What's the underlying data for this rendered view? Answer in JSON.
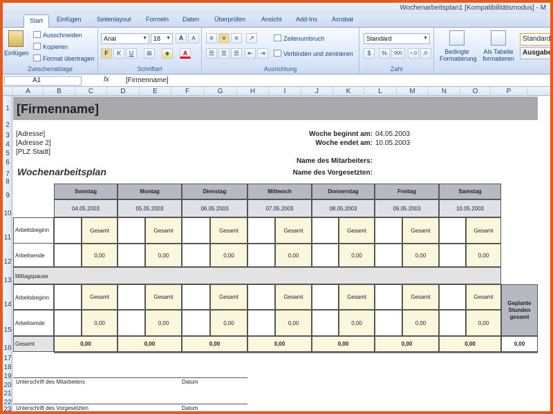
{
  "window": {
    "title": "Wochenarbeitsplan1  [Kompatibilitätsmodus] - M"
  },
  "tabs": [
    "Start",
    "Einfügen",
    "Seitenlayout",
    "Formeln",
    "Daten",
    "Überprüfen",
    "Ansicht",
    "Add-Ins",
    "Acrobat"
  ],
  "ribbon": {
    "clipboard": {
      "label": "Zwischenablage",
      "paste": "Einfügen",
      "cut": "Ausschneiden",
      "copy": "Kopieren",
      "format_painter": "Format übertragen"
    },
    "font": {
      "label": "Schriftart",
      "family": "Arial",
      "size": "18",
      "bold": "F",
      "italic": "K",
      "underline": "U"
    },
    "alignment": {
      "label": "Ausrichtung",
      "wrap": "Zeilenumbruch",
      "merge": "Verbinden und zentrieren"
    },
    "number": {
      "label": "Zahl",
      "format": "Standard",
      "percent": "%",
      "thousands": "000"
    },
    "styles": {
      "conditional": "Bedingte Formatierung",
      "as_table": "Als Tabelle formatieren",
      "style1": "Standard",
      "style2": "Ausgabe"
    }
  },
  "formula_bar": {
    "cell": "A1",
    "fx": "fx",
    "content": "[Firmenname]"
  },
  "columns": [
    "A",
    "B",
    "C",
    "D",
    "E",
    "F",
    "G",
    "H",
    "I",
    "J",
    "K",
    "L",
    "M",
    "N",
    "O",
    "P"
  ],
  "rows": [
    "1",
    "2",
    "3",
    "4",
    "5",
    "6",
    "7",
    "8",
    "9",
    "10",
    "11",
    "12",
    "13",
    "14",
    "15",
    "16",
    "17",
    "18",
    "19",
    "20",
    "21",
    "22",
    "23"
  ],
  "sheet": {
    "company": "[Firmenname]",
    "address": [
      "[Adresse]",
      "[Adresse 2]",
      "[PLZ Stadt]"
    ],
    "week_start_label": "Woche beginnt am:",
    "week_start": "04.05.2003",
    "week_end_label": "Woche endet am:",
    "week_end": "10.05.2003",
    "employee_label": "Name des Mitarbeiters:",
    "supervisor_label": "Name des Vorgesetzten:",
    "plan_title": "Wochenarbeitsplan",
    "days": [
      "Sonntag",
      "Montag",
      "Dienstag",
      "Mittwoch",
      "Donnerstag",
      "Freitag",
      "Samstag"
    ],
    "dates": [
      "04.05.2003",
      "05.05.2003",
      "06.05.2003",
      "07.05.2003",
      "08.05.2003",
      "09.05.2003",
      "10.05.2003"
    ],
    "start_label": "Arbeitsbeginn",
    "end_label": "Arbeitsende",
    "total_label": "Gesamt",
    "lunch_label": "Mittagspause",
    "zero": "0,00",
    "planned_hours": "Geplante Stunden gesamt",
    "sum_label": "Gesamt",
    "sig_employee": "Unterschrift des Mitarbeiters",
    "sig_supervisor": "Unterschrift des Vorgesetzten",
    "date_label": "Datum"
  }
}
